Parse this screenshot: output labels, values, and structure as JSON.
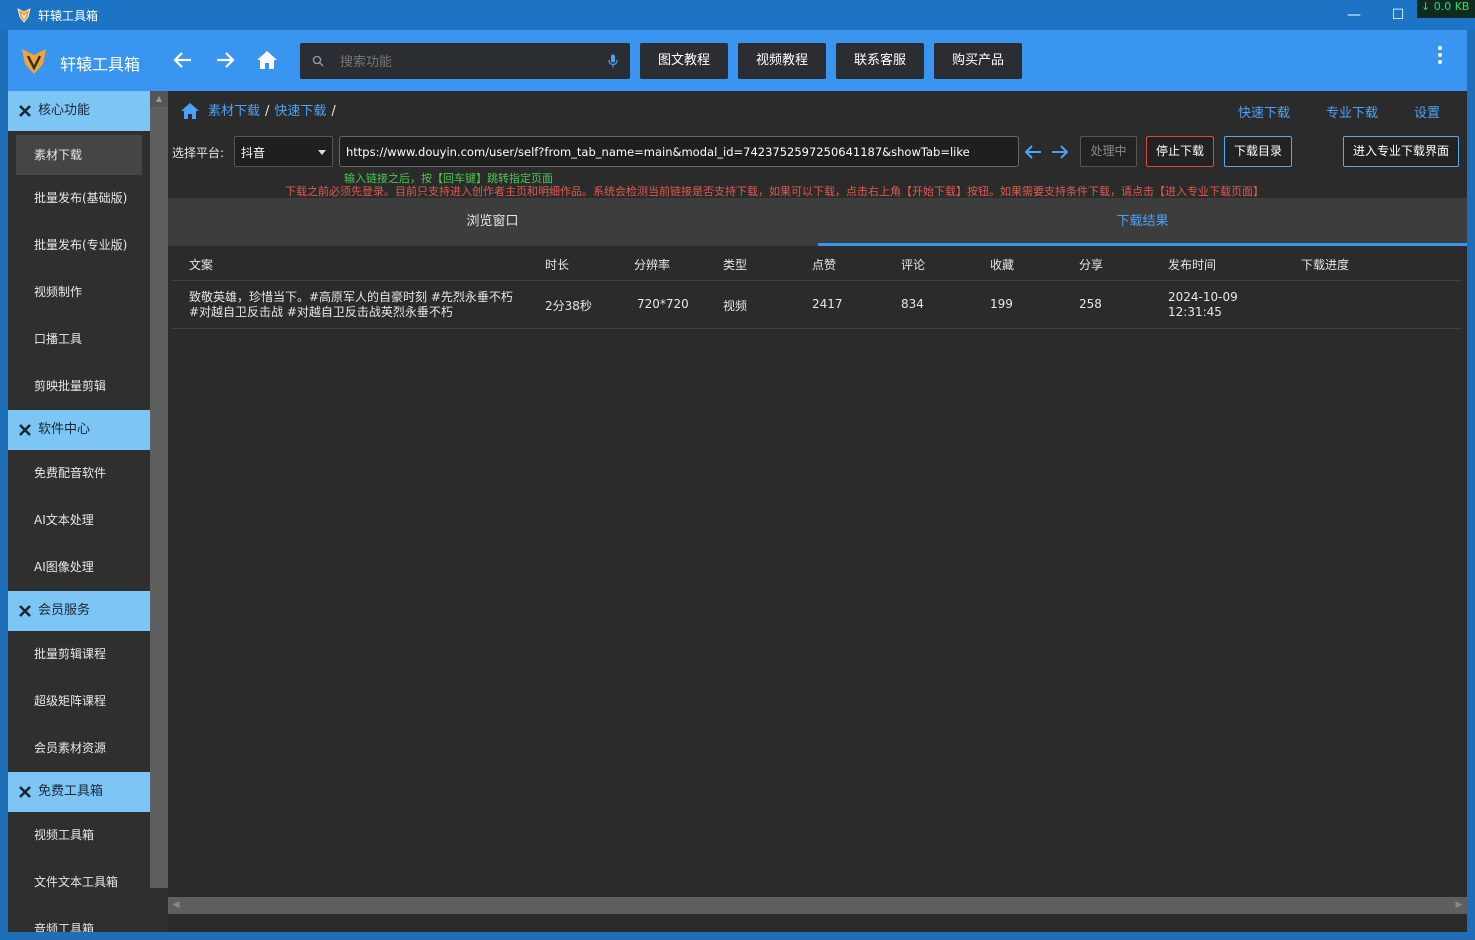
{
  "window": {
    "title": "轩辕工具箱",
    "net_speed": "↓ 0.0 KB",
    "minimize_glyph": "—",
    "maximize_glyph": "☐"
  },
  "header": {
    "brand": "轩辕工具箱",
    "search_placeholder": "搜索功能",
    "buttons": [
      "图文教程",
      "视频教程",
      "联系客服",
      "购买产品"
    ]
  },
  "sidebar": {
    "sections": [
      {
        "title": "核心功能",
        "items": [
          "素材下载",
          "批量发布(基础版)",
          "批量发布(专业版)",
          "视频制作",
          "口播工具",
          "剪映批量剪辑"
        ]
      },
      {
        "title": "软件中心",
        "items": [
          "免费配音软件",
          "AI文本处理",
          "AI图像处理"
        ]
      },
      {
        "title": "会员服务",
        "items": [
          "批量剪辑课程",
          "超级矩阵课程",
          "会员素材资源"
        ]
      },
      {
        "title": "免费工具箱",
        "items": [
          "视频工具箱",
          "文件文本工具箱",
          "音频工具箱"
        ]
      }
    ]
  },
  "breadcrumb": {
    "crumb1": "素材下载",
    "crumb2": "快速下载",
    "sep": "/"
  },
  "top_links": [
    "快速下载",
    "专业下载",
    "设置"
  ],
  "toolbar": {
    "platform_label": "选择平台:",
    "platform_value": "抖音",
    "url": "https://www.douyin.com/user/self?from_tab_name=main&modal_id=7423752597250641187&showTab=like",
    "processing": "处理中",
    "stop": "停止下载",
    "folder": "下载目录",
    "pro": "进入专业下载界面"
  },
  "hints": {
    "green": "输入链接之后，按【回车键】跳转指定页面",
    "red": "下载之前必须先登录。目前只支持进入创作者主页和明细作品。系统会检测当前链接是否支持下载，如果可以下载，点击右上角【开始下载】按钮。如果需要支持条件下载，请点击【进入专业下载页面】"
  },
  "tabs": [
    "浏览窗口",
    "下载结果"
  ],
  "table": {
    "columns": [
      "文案",
      "时长",
      "分辨率",
      "类型",
      "点赞",
      "评论",
      "收藏",
      "分享",
      "发布时间",
      "下载进度"
    ],
    "rows": [
      {
        "text_line1": "致敬英雄，珍惜当下。#高原军人的自豪时刻 #先烈永垂不朽",
        "text_line2": "#对越自卫反击战 #对越自卫反击战英烈永垂不朽",
        "duration": "2分38秒",
        "resolution": "720*720",
        "type": "视频",
        "likes": "2417",
        "comments": "834",
        "favorites": "199",
        "shares": "258",
        "date": "2024-10-09",
        "time": "12:31:45",
        "progress": ""
      }
    ]
  }
}
